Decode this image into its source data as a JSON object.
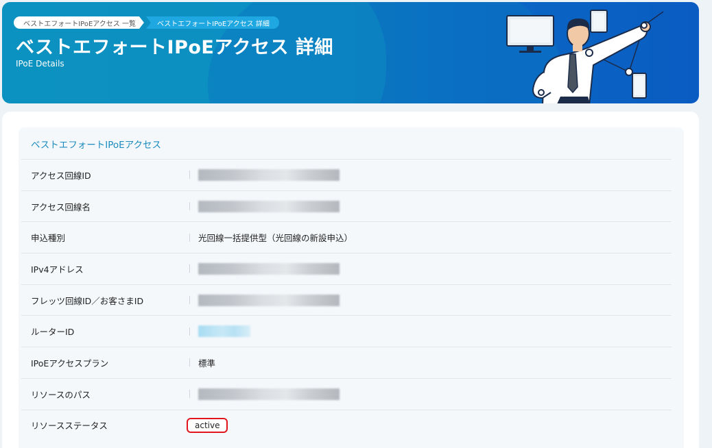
{
  "breadcrumb": {
    "items": [
      {
        "label": "ベストエフォートIPoEアクセス 一覧"
      },
      {
        "label": "ベストエフォートIPoEアクセス 詳細"
      }
    ]
  },
  "header": {
    "title": "ベストエフォートIPoEアクセス 詳細",
    "subtitle": "IPoE Details"
  },
  "section": {
    "title": "ベストエフォートIPoEアクセス",
    "rows": [
      {
        "label": "アクセス回線ID",
        "value": "",
        "redacted": true
      },
      {
        "label": "アクセス回線名",
        "value": "",
        "redacted": true
      },
      {
        "label": "申込種別",
        "value": "光回線一括提供型（光回線の新設申込）",
        "redacted": false
      },
      {
        "label": "IPv4アドレス",
        "value": "",
        "redacted": true
      },
      {
        "label": "フレッツ回線ID／お客さまID",
        "value": "",
        "redacted": true
      },
      {
        "label": "ルーターID",
        "value": "",
        "redacted": true
      },
      {
        "label": "IPoEアクセスプラン",
        "value": "標準",
        "redacted": false
      },
      {
        "label": "リソースのパス",
        "value": "",
        "redacted": true
      },
      {
        "label": "リソースステータス",
        "value": "active",
        "redacted": false,
        "highlighted": true
      }
    ]
  },
  "colors": {
    "banner": "#0a7cc0",
    "section_title": "#1a8bbf",
    "highlight_border": "#e0141b"
  }
}
